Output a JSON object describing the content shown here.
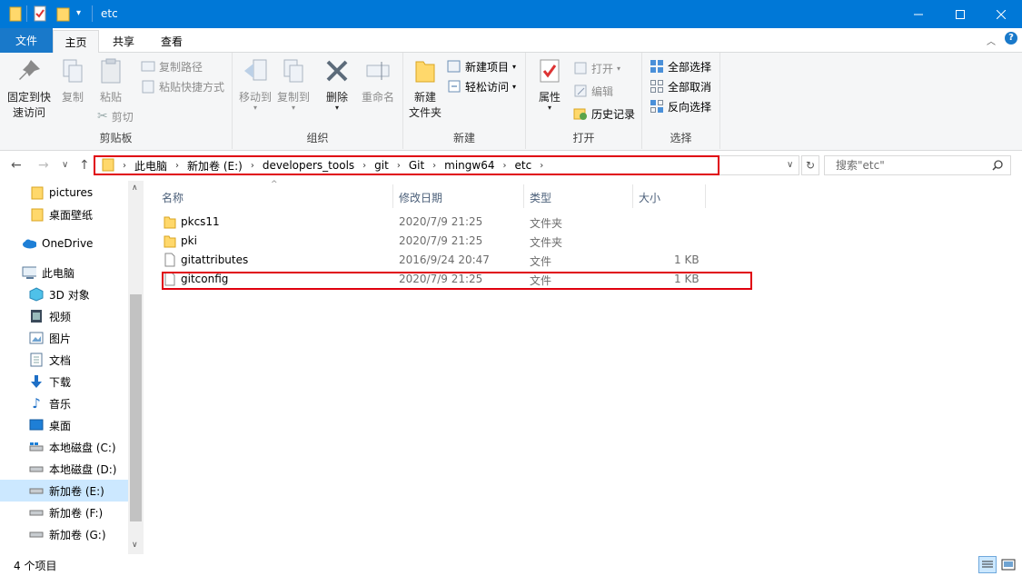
{
  "window": {
    "title": "etc",
    "controls": [
      "minimize-icon",
      "maximize-icon",
      "close-icon"
    ]
  },
  "ribbon_tabs": [
    "文件",
    "主页",
    "共享",
    "查看"
  ],
  "ribbon": {
    "clipboard": {
      "pin": "固定到快\n速访问",
      "copy": "复制",
      "paste": "粘贴",
      "copy_path": "复制路径",
      "paste_shortcut": "粘贴快捷方式",
      "cut": "剪切",
      "label": "剪贴板"
    },
    "organize": {
      "move_to": "移动到",
      "copy_to": "复制到",
      "delete": "删除",
      "rename": "重命名",
      "label": "组织"
    },
    "new": {
      "new_folder": "新建\n文件夹",
      "new_item": "新建项目",
      "easy_access": "轻松访问",
      "label": "新建"
    },
    "open": {
      "properties": "属性",
      "open": "打开",
      "edit": "编辑",
      "history": "历史记录",
      "label": "打开"
    },
    "select": {
      "select_all": "全部选择",
      "select_none": "全部取消",
      "invert": "反向选择",
      "label": "选择"
    }
  },
  "address": {
    "crumbs": [
      "此电脑",
      "新加卷 (E:)",
      "developers_tools",
      "git",
      "Git",
      "mingw64",
      "etc"
    ],
    "search_placeholder": "搜索\"etc\""
  },
  "nav": {
    "items": [
      {
        "label": "pictures",
        "icon": "folder-icon"
      },
      {
        "label": "桌面壁纸",
        "icon": "folder-icon"
      },
      {
        "label": "OneDrive",
        "icon": "cloud-icon"
      },
      {
        "label": "此电脑",
        "icon": "computer-icon"
      },
      {
        "label": "3D 对象",
        "icon": "cube-icon"
      },
      {
        "label": "视频",
        "icon": "video-icon"
      },
      {
        "label": "图片",
        "icon": "picture-icon"
      },
      {
        "label": "文档",
        "icon": "document-icon"
      },
      {
        "label": "下载",
        "icon": "download-icon"
      },
      {
        "label": "音乐",
        "icon": "music-icon"
      },
      {
        "label": "桌面",
        "icon": "desktop-icon"
      },
      {
        "label": "本地磁盘 (C:)",
        "icon": "drive-icon"
      },
      {
        "label": "本地磁盘 (D:)",
        "icon": "drive-icon"
      },
      {
        "label": "新加卷 (E:)",
        "icon": "drive-icon"
      },
      {
        "label": "新加卷 (F:)",
        "icon": "drive-icon"
      },
      {
        "label": "新加卷 (G:)",
        "icon": "drive-icon"
      }
    ],
    "selected": "新加卷 (E:)"
  },
  "columns": [
    "名称",
    "修改日期",
    "类型",
    "大小"
  ],
  "files": [
    {
      "name": "pkcs11",
      "date": "2020/7/9 21:25",
      "type": "文件夹",
      "size": "",
      "icon": "folder-icon"
    },
    {
      "name": "pki",
      "date": "2020/7/9 21:25",
      "type": "文件夹",
      "size": "",
      "icon": "folder-icon"
    },
    {
      "name": "gitattributes",
      "date": "2016/9/24 20:47",
      "type": "文件",
      "size": "1 KB",
      "icon": "file-icon"
    },
    {
      "name": "gitconfig",
      "date": "2020/7/9 21:25",
      "type": "文件",
      "size": "1 KB",
      "icon": "file-icon"
    }
  ],
  "status": {
    "count": "4 个项目"
  },
  "colors": {
    "titlebar": "#0078d7",
    "file_tab": "#1979ca",
    "highlight": "#e0000e",
    "selected": "#cce8ff"
  }
}
